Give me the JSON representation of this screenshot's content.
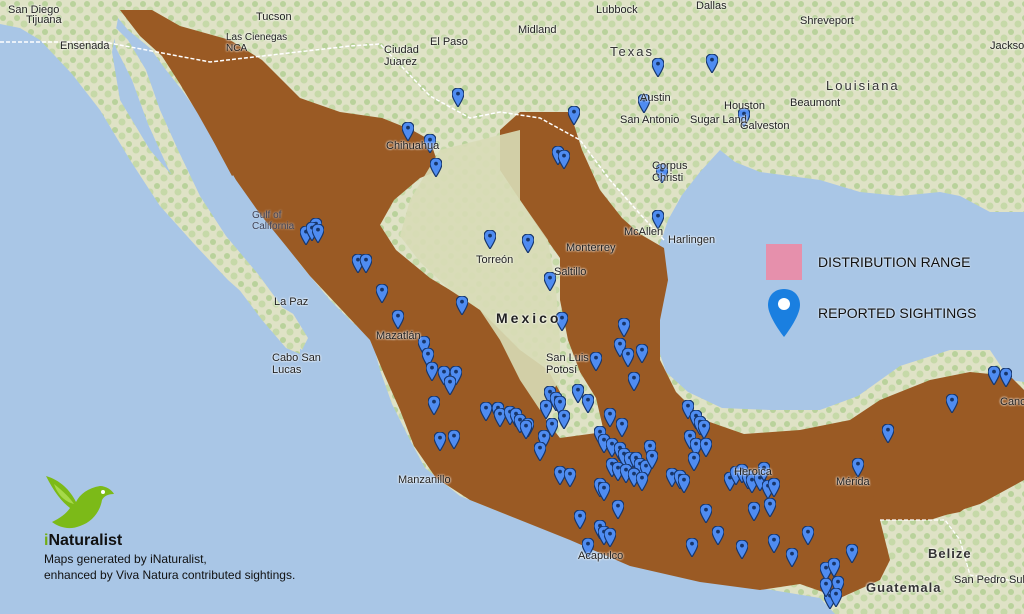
{
  "labels": {
    "san_diego": "San Diego",
    "tijuana": "Tijuana",
    "ensenada": "Ensenada",
    "tucson": "Tucson",
    "las_cienegas": "Las Cienegas\nNCA",
    "el_paso": "El Paso",
    "ciudad_juarez": "Ciudad\nJuarez",
    "lubbock": "Lubbock",
    "midland": "Midland",
    "dallas": "Dallas",
    "texas": "Texas",
    "austin": "Austin",
    "san_antonio": "San Antonio",
    "houston": "Houston",
    "beaumont": "Beaumont",
    "louisiana": "Louisiana",
    "shreveport": "Shreveport",
    "jackson": "Jackson",
    "corpus_christi": "Corpus\nChristi",
    "sugar_land": "Sugar Land",
    "galveston": "Galveston",
    "mcallen": "McAllen",
    "harlingen": "Harlingen",
    "chihuahua": "Chihuahua",
    "torreon": "Torreón",
    "monterrey": "Monterrey",
    "saltillo": "Saltillo",
    "mexico": "Mexico",
    "gulf_of_california": "Gulf of\nCalifornia",
    "la_paz": "La Paz",
    "cabo_san_lucas": "Cabo San\nLucas",
    "mazatlan": "Mazatlán",
    "san_luis_potosi": "San Luis\nPotosí",
    "manzanillo": "Manzanillo",
    "acapulco": "Acapulco",
    "heroica": "Heroica",
    "belize": "Belize",
    "guatemala": "Guatemala",
    "san_pedro_sula": "San Pedro Sula",
    "cancun": "Cancún",
    "merida": "Mérida"
  },
  "legend": {
    "distribution_label": "DISTRIBUTION RANGE",
    "sightings_label": "REPORTED SIGHTINGS",
    "distribution_color": "#e690ac",
    "pin_color": "#1a7fe0"
  },
  "credit": {
    "brand_prefix": "i",
    "brand_name": "Naturalist",
    "line1": "Maps generated by iNaturalist,",
    "line2": "enhanced by Viva Natura contributed sightings."
  },
  "colors": {
    "ocean": "#a9c6e6",
    "land": "#e8e4cf",
    "vegetation": "#bcd49f",
    "range_fill": "#9a5a24",
    "pin": "#4f8cf1",
    "pin_dark": "#17366b"
  },
  "sightings_count": 155
}
